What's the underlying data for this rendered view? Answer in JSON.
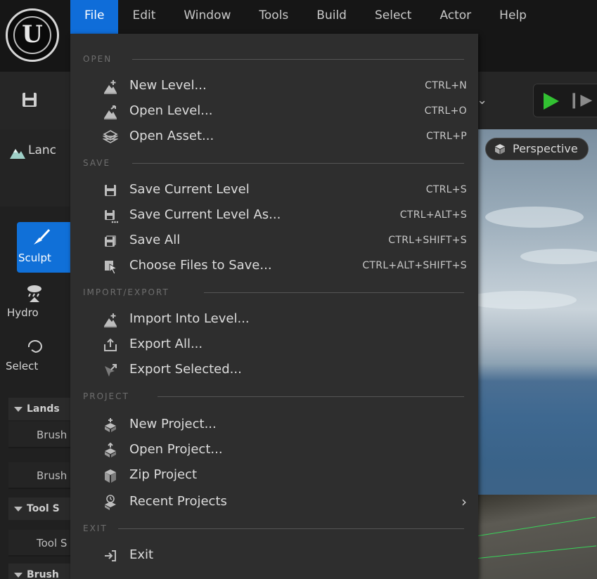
{
  "menubar": {
    "items": [
      "File",
      "Edit",
      "Window",
      "Tools",
      "Build",
      "Select",
      "Actor",
      "Help"
    ],
    "active": "File"
  },
  "left_panel": {
    "tab_label": "Lanc",
    "modes": [
      {
        "label": "Sculpt",
        "icon": "sculpt-brush-icon",
        "active": true
      },
      {
        "label": "Hydro",
        "icon": "hydro-rain-icon",
        "active": false
      },
      {
        "label": "Select",
        "icon": "select-lasso-icon",
        "active": false
      }
    ],
    "sections": [
      {
        "label": "Lands",
        "rows": [
          "Brush",
          "Brush"
        ]
      },
      {
        "label": "Tool S",
        "rows": [
          "Tool S"
        ]
      },
      {
        "label": "Brush"
      }
    ]
  },
  "viewport": {
    "perspective_label": "Perspective"
  },
  "file_menu": {
    "sections": [
      {
        "label": "OPEN",
        "items": [
          {
            "label": "New Level...",
            "shortcut": "CTRL+N",
            "icon": "new-level-icon"
          },
          {
            "label": "Open Level...",
            "shortcut": "CTRL+O",
            "icon": "open-level-icon"
          },
          {
            "label": "Open Asset...",
            "shortcut": "CTRL+P",
            "icon": "open-asset-icon"
          }
        ]
      },
      {
        "label": "SAVE",
        "items": [
          {
            "label": "Save Current Level",
            "shortcut": "CTRL+S",
            "icon": "save-icon"
          },
          {
            "label": "Save Current Level As...",
            "shortcut": "CTRL+ALT+S",
            "icon": "save-as-icon"
          },
          {
            "label": "Save All",
            "shortcut": "CTRL+SHIFT+S",
            "icon": "save-all-icon"
          },
          {
            "label": "Choose Files to Save...",
            "shortcut": "CTRL+ALT+SHIFT+S",
            "icon": "choose-files-icon"
          }
        ]
      },
      {
        "label": "IMPORT/EXPORT",
        "items": [
          {
            "label": "Import Into Level...",
            "shortcut": "",
            "icon": "import-icon"
          },
          {
            "label": "Export All...",
            "shortcut": "",
            "icon": "export-all-icon"
          },
          {
            "label": "Export Selected...",
            "shortcut": "",
            "icon": "export-selected-icon"
          }
        ]
      },
      {
        "label": "PROJECT",
        "items": [
          {
            "label": "New Project...",
            "shortcut": "",
            "icon": "new-project-icon"
          },
          {
            "label": "Open Project...",
            "shortcut": "",
            "icon": "open-project-icon"
          },
          {
            "label": "Zip Project",
            "shortcut": "",
            "icon": "zip-project-icon"
          },
          {
            "label": "Recent Projects",
            "shortcut": "",
            "icon": "recent-projects-icon",
            "submenu": true
          }
        ]
      },
      {
        "label": "EXIT",
        "items": [
          {
            "label": "Exit",
            "shortcut": "",
            "icon": "exit-icon"
          }
        ]
      }
    ]
  },
  "colors": {
    "accent": "#0f6dd9",
    "menu_bg": "#2e2e2e",
    "play_green": "#32c132"
  }
}
